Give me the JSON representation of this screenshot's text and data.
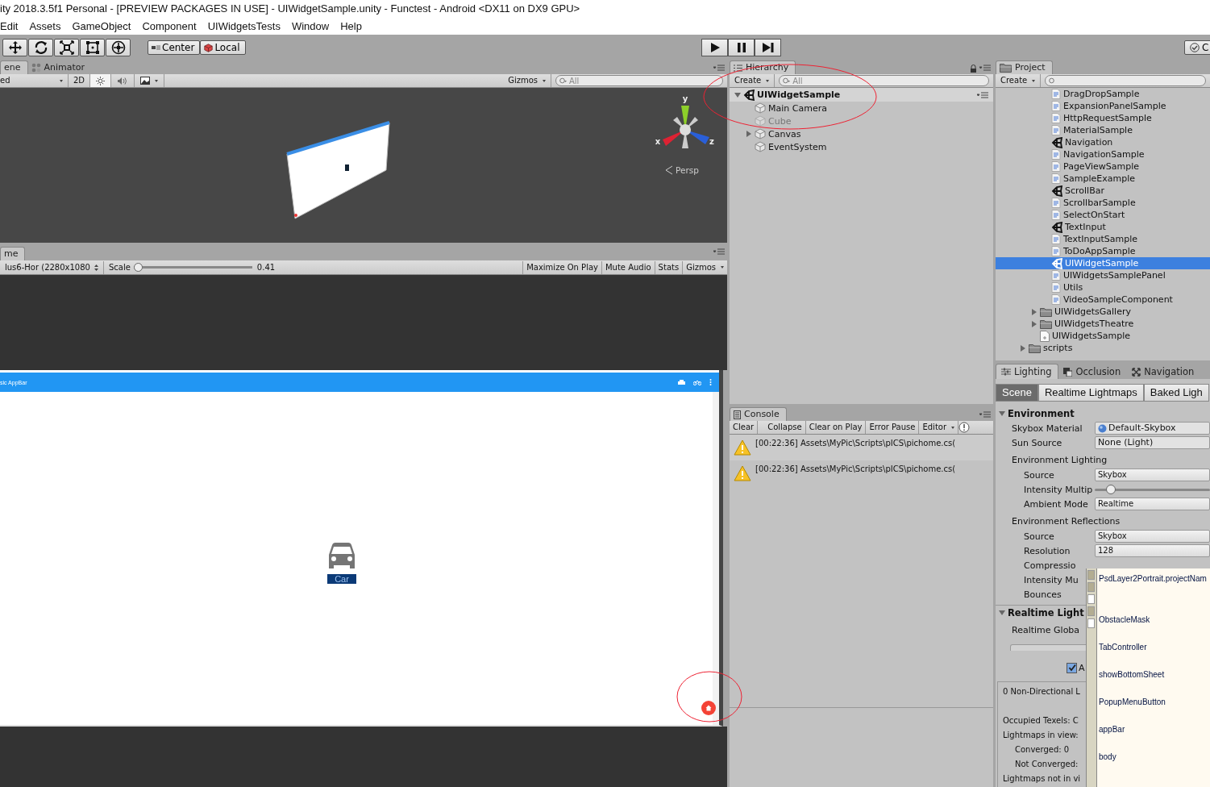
{
  "window": {
    "title": "ity 2018.3.5f1 Personal - [PREVIEW PACKAGES IN USE] - UIWidgetSample.unity - Functest - Android <DX11 on DX9 GPU>"
  },
  "menu": [
    "Edit",
    "Assets",
    "GameObject",
    "Component",
    "UIWidgetsTests",
    "Window",
    "Help"
  ],
  "toolbar": {
    "tools": [
      {
        "kind": "move",
        "selected": false
      },
      {
        "kind": "rotate",
        "selected": false
      },
      {
        "kind": "scale",
        "selected": false
      },
      {
        "kind": "rect",
        "selected": false
      },
      {
        "kind": "transform",
        "selected": false
      }
    ],
    "pivot": [
      {
        "kind": "center",
        "label": "Center"
      },
      {
        "kind": "local",
        "label": "Local"
      }
    ],
    "playback": [
      {
        "kind": "play",
        "selected": false
      },
      {
        "kind": "pause",
        "selected": false
      },
      {
        "kind": "step",
        "selected": false
      }
    ],
    "collab": "C"
  },
  "scene": {
    "tabs": [
      {
        "kind": "scene",
        "label": "ene",
        "selected": true
      },
      {
        "kind": "animator",
        "label": "Animator",
        "selected": false
      }
    ],
    "draw_mode": "ed",
    "mode_2d": "2D",
    "toggles": [
      {
        "kind": "lighting",
        "on": true
      },
      {
        "kind": "audio",
        "on": false
      },
      {
        "kind": "effects",
        "on": false
      }
    ],
    "gizmos": "Gizmos",
    "search_placeholder": "All",
    "axis_labels": [
      "y",
      "x",
      "z"
    ],
    "projection": "Persp"
  },
  "game": {
    "tab": "me",
    "resolution": "lus6-Hor (2280x1080",
    "scale_label": "Scale",
    "scale": {
      "level": 0
    },
    "scale_value": "0.41",
    "buttons": [
      "Maximize On Play",
      "Mute Audio",
      "Stats",
      "Gizmos"
    ],
    "app": {
      "title": "sic AppBar",
      "button_label": "Car"
    }
  },
  "hierarchy": {
    "tab": "Hierarchy",
    "create": "Create",
    "search_placeholder": "All",
    "scene": "UIWidgetSample",
    "items": [
      {
        "label": "Main Camera",
        "disabled": false,
        "expandable": false
      },
      {
        "label": "Cube",
        "disabled": true,
        "expandable": false
      },
      {
        "label": "Canvas",
        "disabled": false,
        "expandable": true
      },
      {
        "label": "EventSystem",
        "disabled": false,
        "expandable": false
      }
    ]
  },
  "console": {
    "tab": "Console",
    "buttons": [
      "Clear",
      "Collapse",
      "Clear on Play",
      "Error Pause",
      "Editor"
    ],
    "messages": [
      {
        "kind": "warning",
        "text": "[00:22:36] Assets\\MyPic\\Scripts\\pICS\\pichome.cs("
      },
      {
        "kind": "warning",
        "text": "[00:22:36] Assets\\MyPic\\Scripts\\pICS\\pichome.cs("
      }
    ]
  },
  "project": {
    "tab": "Project",
    "create": "Create",
    "tree": [
      {
        "children": [
          {
            "children": [
              {
                "kind": "script",
                "label": "DragDropSample",
                "selected": false
              },
              {
                "kind": "script",
                "label": "ExpansionPanelSample",
                "selected": false
              },
              {
                "kind": "script",
                "label": "HttpRequestSample",
                "selected": false
              },
              {
                "kind": "script",
                "label": "MaterialSample",
                "selected": false
              },
              {
                "kind": "scene",
                "label": "Navigation",
                "selected": false
              },
              {
                "kind": "script",
                "label": "NavigationSample",
                "selected": false
              },
              {
                "kind": "script",
                "label": "PageViewSample",
                "selected": false
              },
              {
                "kind": "script",
                "label": "SampleExample",
                "selected": false
              },
              {
                "kind": "scene",
                "label": "ScrollBar",
                "selected": false
              },
              {
                "kind": "script",
                "label": "ScrollbarSample",
                "selected": false
              },
              {
                "kind": "script",
                "label": "SelectOnStart",
                "selected": false
              },
              {
                "kind": "scene",
                "label": "TextInput",
                "selected": false
              },
              {
                "kind": "script",
                "label": "TextInputSample",
                "selected": false
              },
              {
                "kind": "script",
                "label": "ToDoAppSample",
                "selected": false
              },
              {
                "kind": "scene",
                "label": "UIWidgetSample",
                "selected": true
              },
              {
                "kind": "script",
                "label": "UIWidgetsSamplePanel",
                "selected": false
              },
              {
                "kind": "script",
                "label": "Utils",
                "selected": false
              },
              {
                "kind": "script",
                "label": "VideoSampleComponent",
                "selected": false
              }
            ]
          },
          {
            "kind": "folder",
            "label": "UIWidgetsGallery",
            "selected": false,
            "expanded": false
          },
          {
            "kind": "folder",
            "label": "UIWidgetsTheatre",
            "selected": false,
            "expanded": false
          },
          {
            "kind": "asset",
            "label": "UIWidgetsSample",
            "selected": false
          }
        ]
      },
      {
        "kind": "folder",
        "label": "scripts",
        "selected": false,
        "expanded": false
      }
    ]
  },
  "lighting": {
    "tabs": [
      {
        "kind": "lighting",
        "label": "Lighting",
        "selected": true
      },
      {
        "kind": "occlusion",
        "label": "Occlusion",
        "selected": false
      },
      {
        "kind": "navigation",
        "label": "Navigation",
        "selected": false
      }
    ],
    "subtabs": [
      {
        "label": "Scene",
        "selected": true
      },
      {
        "label": "Realtime Lightmaps",
        "selected": false
      },
      {
        "label": "Baked Ligh",
        "selected": false
      }
    ],
    "rows": [
      {
        "kind": "header",
        "label": "Environment",
        "expanded": true
      },
      {
        "kind": "object",
        "label": "Skybox Material",
        "value": "Default-Skybox"
      },
      {
        "kind": "field",
        "label": "Sun Source",
        "value": "None (Light)"
      },
      {
        "kind": "group",
        "label": "Environment Lighting"
      },
      {
        "kind": "dropdown",
        "label": "Source",
        "value": "Skybox"
      },
      {
        "kind": "slider",
        "label": "Intensity Multip",
        "level": 0.1
      },
      {
        "kind": "dropdown",
        "label": "Ambient Mode",
        "value": "Realtime"
      },
      {
        "kind": "group",
        "label": "Environment Reflections"
      },
      {
        "kind": "dropdown",
        "label": "Source",
        "value": "Skybox"
      },
      {
        "kind": "dropdown",
        "label": "Resolution",
        "value": "128"
      },
      {
        "kind": "sub",
        "label": "Compressio"
      },
      {
        "kind": "sub",
        "label": "Intensity Mu"
      },
      {
        "kind": "sub",
        "label": "Bounces"
      },
      {
        "kind": "header",
        "label": "Realtime Light",
        "expanded": true
      },
      {
        "kind": "group",
        "label": "Realtime Globa"
      },
      {
        "kind": "bar"
      },
      {
        "kind": "checkbox",
        "label": "A",
        "checked": true
      }
    ],
    "info": [
      {
        "text": "0 Non-Directional L"
      },
      {
        "text": "Occupied Texels: C"
      },
      {
        "text": "Lightmaps in view:",
        "children": [
          {
            "text": "Converged: 0"
          },
          {
            "text": "Not Converged:"
          }
        ]
      },
      {
        "text": "Lightmaps not in vi"
      }
    ]
  },
  "popup": {
    "markers": [
      {
        "filled": true
      },
      {
        "filled": true
      },
      {
        "filled": false
      },
      {
        "filled": true
      },
      {
        "filled": false
      }
    ],
    "items": [
      "PsdLayer2Portrait.projectNam",
      "ObstacleMask",
      "TabController",
      "showBottomSheet",
      "PopupMenuButton",
      "appBar",
      "body"
    ]
  }
}
